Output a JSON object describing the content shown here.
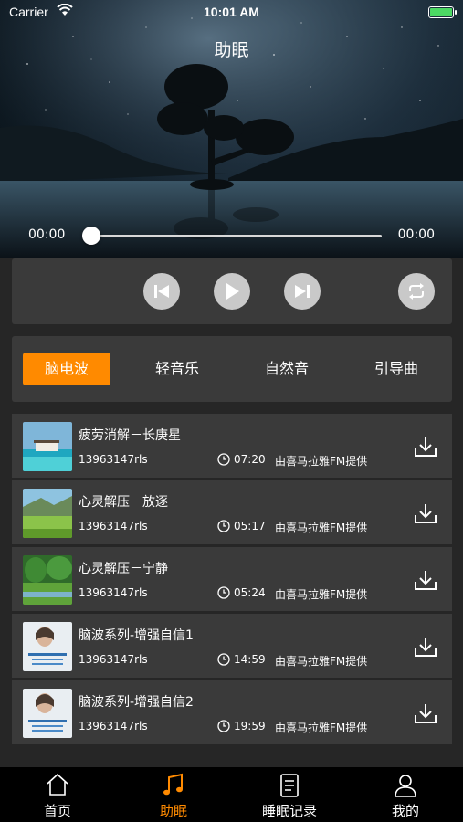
{
  "status_bar": {
    "carrier": "Carrier",
    "time": "10:01 AM"
  },
  "header": {
    "title": "助眠"
  },
  "player": {
    "current_time": "00:00",
    "total_time": "00:00",
    "progress": 0
  },
  "tabs": [
    {
      "label": "脑电波",
      "active": true
    },
    {
      "label": "轻音乐",
      "active": false
    },
    {
      "label": "自然音",
      "active": false
    },
    {
      "label": "引导曲",
      "active": false
    }
  ],
  "tracks": [
    {
      "title": "疲劳消解－长庚星",
      "plays": "13963147rls",
      "duration": "07:20",
      "source": "由喜马拉雅FM提供",
      "thumb": "beach"
    },
    {
      "title": "心灵解压－放逐",
      "plays": "13963147rls",
      "duration": "05:17",
      "source": "由喜马拉雅FM提供",
      "thumb": "meadow"
    },
    {
      "title": "心灵解压－宁静",
      "plays": "13963147rls",
      "duration": "05:24",
      "source": "由喜马拉雅FM提供",
      "thumb": "forest"
    },
    {
      "title": "脑波系列-增强自信1",
      "plays": "13963147rls",
      "duration": "14:59",
      "source": "由喜马拉雅FM提供",
      "thumb": "person"
    },
    {
      "title": "脑波系列-增强自信2",
      "plays": "13963147rls",
      "duration": "19:59",
      "source": "由喜马拉雅FM提供",
      "thumb": "person"
    }
  ],
  "bottom_nav": [
    {
      "label": "首页",
      "icon": "home-icon",
      "active": false
    },
    {
      "label": "助眠",
      "icon": "music-note-icon",
      "active": true
    },
    {
      "label": "睡眠记录",
      "icon": "document-icon",
      "active": false
    },
    {
      "label": "我的",
      "icon": "user-icon",
      "active": false
    }
  ],
  "colors": {
    "accent": "#ff8a00",
    "panel": "#3a3a3a",
    "background": "#262626",
    "battery": "#4cd964"
  }
}
